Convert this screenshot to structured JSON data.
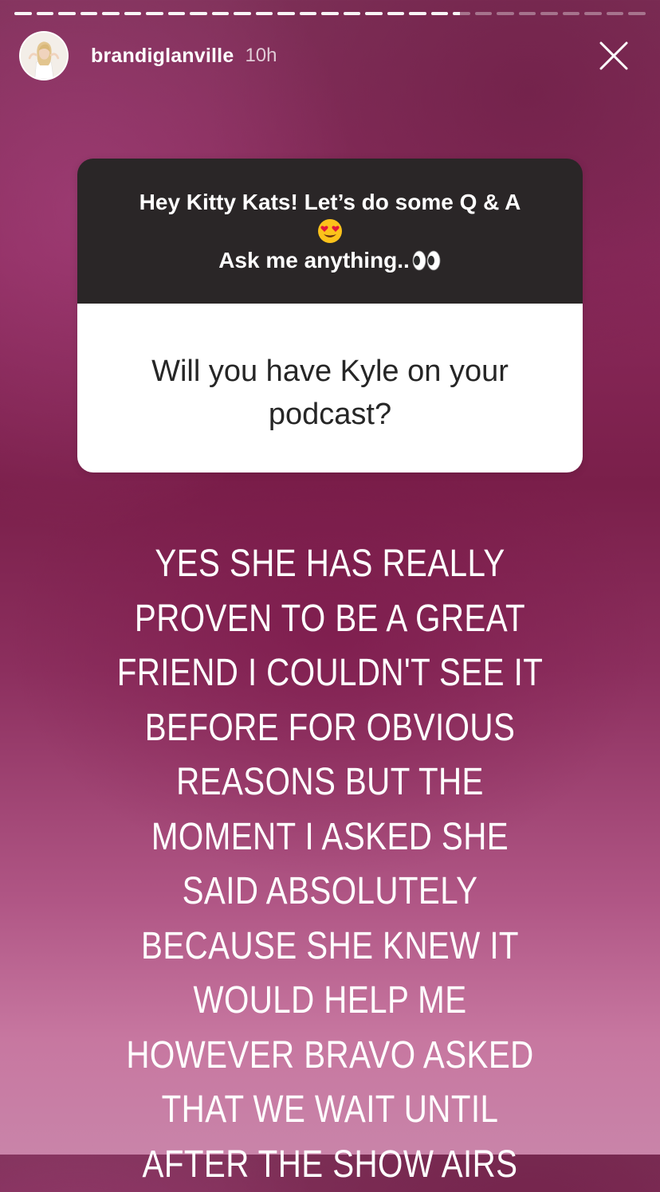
{
  "story": {
    "progress": {
      "segments_total": 29,
      "segments_complete": 20,
      "current_segment_fraction": 0.4
    },
    "header": {
      "username": "brandiglanville",
      "time": "10h",
      "avatar_icon": "profile-photo",
      "close_icon": "close-icon"
    },
    "question_sticker": {
      "prompt_line1": "Hey Kitty Kats! Let’s do some Q & A",
      "prompt_emoji": "heart-eyes-emoji",
      "prompt_line2": "Ask me anything..",
      "prompt_line2_emoji": "eyes-emoji",
      "question": "Will you have Kyle on your podcast?"
    },
    "response": {
      "text": "YES SHE HAS REALLY PROVEN TO BE A GREAT FRIEND I COULDN'T SEE IT BEFORE FOR OBVIOUS REASONS BUT THE MOMENT I ASKED SHE SAID ABSOLUTELY BECAUSE SHE KNEW IT WOULD HELP ME HOWEVER BRAVO ASKED THAT WE WAIT UNTIL AFTER THE SHOW AIRS"
    },
    "colors": {
      "prompt_background": "#2a2627",
      "card_white": "#ffffff",
      "text_white": "#ffffff"
    }
  }
}
